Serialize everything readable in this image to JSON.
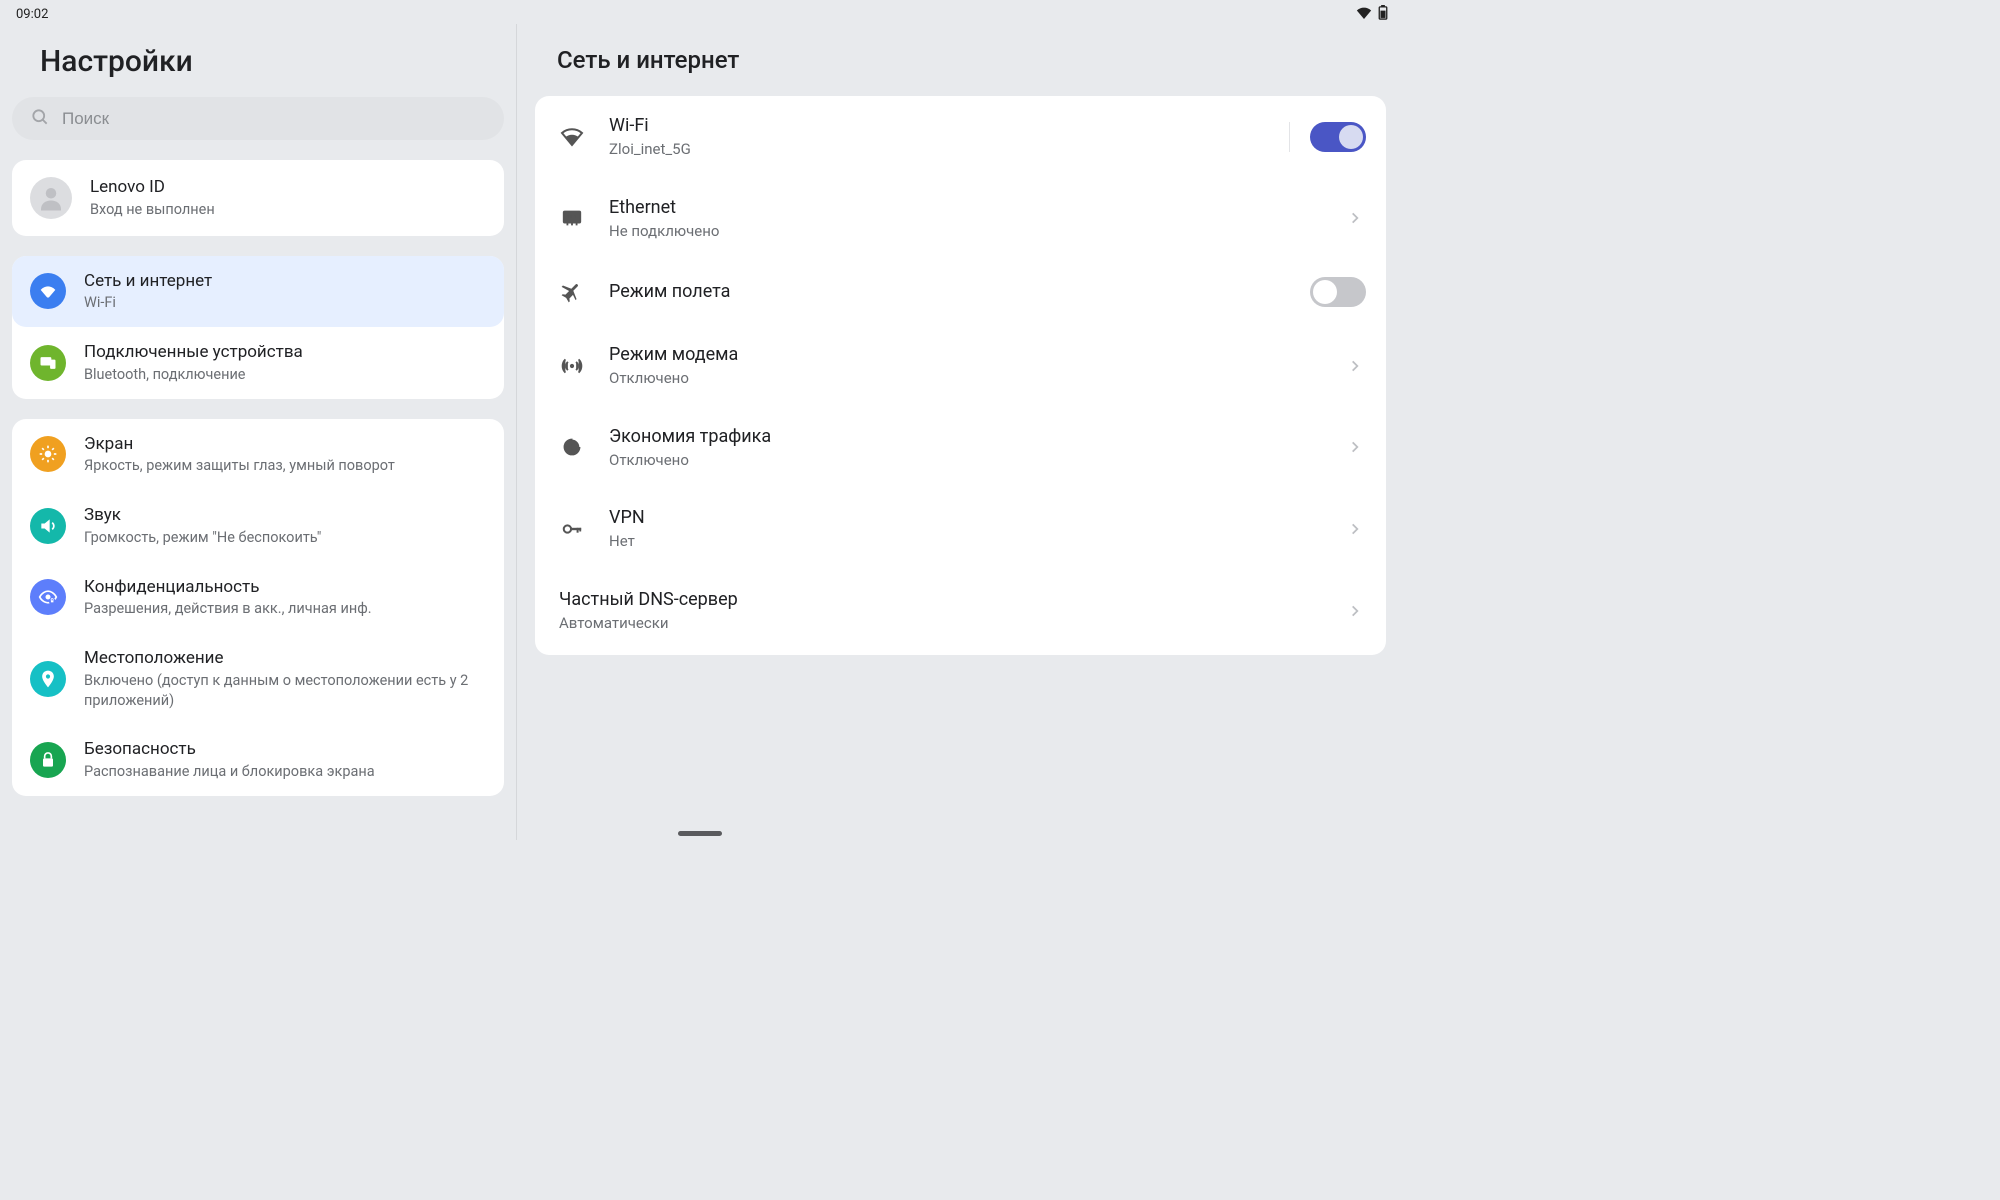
{
  "status": {
    "time": "09:02"
  },
  "sidebar": {
    "title": "Настройки",
    "search_placeholder": "Поиск",
    "account": {
      "title": "Lenovo ID",
      "sub": "Вход не выполнен"
    },
    "groups": [
      {
        "items": [
          {
            "id": "network",
            "title": "Сеть и интернет",
            "sub": "Wi-Fi",
            "color": "#3b7ef0",
            "selected": true,
            "icon": "wifi"
          },
          {
            "id": "devices",
            "title": "Подключенные устройства",
            "sub": "Bluetooth, подключение",
            "color": "#6fb52d",
            "selected": false,
            "icon": "devices"
          }
        ]
      },
      {
        "items": [
          {
            "id": "display",
            "title": "Экран",
            "sub": "Яркость, режим защиты глаз, умный поворот",
            "color": "#f0a020",
            "selected": false,
            "icon": "brightness"
          },
          {
            "id": "sound",
            "title": "Звук",
            "sub": "Громкость, режим \"Не беспокоить\"",
            "color": "#14b8aa",
            "selected": false,
            "icon": "sound"
          },
          {
            "id": "privacy",
            "title": "Конфиденциальность",
            "sub": "Разрешения, действия в акк., личная инф.",
            "color": "#5d7efb",
            "selected": false,
            "icon": "privacy"
          },
          {
            "id": "location",
            "title": "Местоположение",
            "sub": "Включено (доступ к данным о местоположении есть у 2 приложений)",
            "color": "#16c0c5",
            "selected": false,
            "icon": "location"
          },
          {
            "id": "security",
            "title": "Безопасность",
            "sub": "Распознавание лица и блокировка экрана",
            "color": "#18a551",
            "selected": false,
            "icon": "security"
          }
        ]
      }
    ]
  },
  "detail": {
    "title": "Сеть и интернет",
    "items": [
      {
        "id": "wifi",
        "title": "Wi-Fi",
        "sub": "Zloi_inet_5G",
        "icon": "wifi",
        "control": "toggle",
        "toggle_on": true,
        "chevron": false,
        "divider": true
      },
      {
        "id": "ethernet",
        "title": "Ethernet",
        "sub": "Не подключено",
        "icon": "ethernet",
        "control": "nav",
        "chevron": true
      },
      {
        "id": "airplane",
        "title": "Режим полета",
        "sub": null,
        "icon": "airplane",
        "control": "toggle",
        "toggle_on": false,
        "chevron": false
      },
      {
        "id": "hotspot",
        "title": "Режим модема",
        "sub": "Отключено",
        "icon": "hotspot",
        "control": "nav",
        "chevron": true
      },
      {
        "id": "datasaver",
        "title": "Экономия трафика",
        "sub": "Отключено",
        "icon": "datasaver",
        "control": "nav",
        "chevron": true
      },
      {
        "id": "vpn",
        "title": "VPN",
        "sub": "Нет",
        "icon": "vpn",
        "control": "nav",
        "chevron": true
      },
      {
        "id": "privatedns",
        "title": "Частный DNS-сервер",
        "sub": "Автоматически",
        "icon": null,
        "control": "nav",
        "chevron": true
      }
    ]
  }
}
